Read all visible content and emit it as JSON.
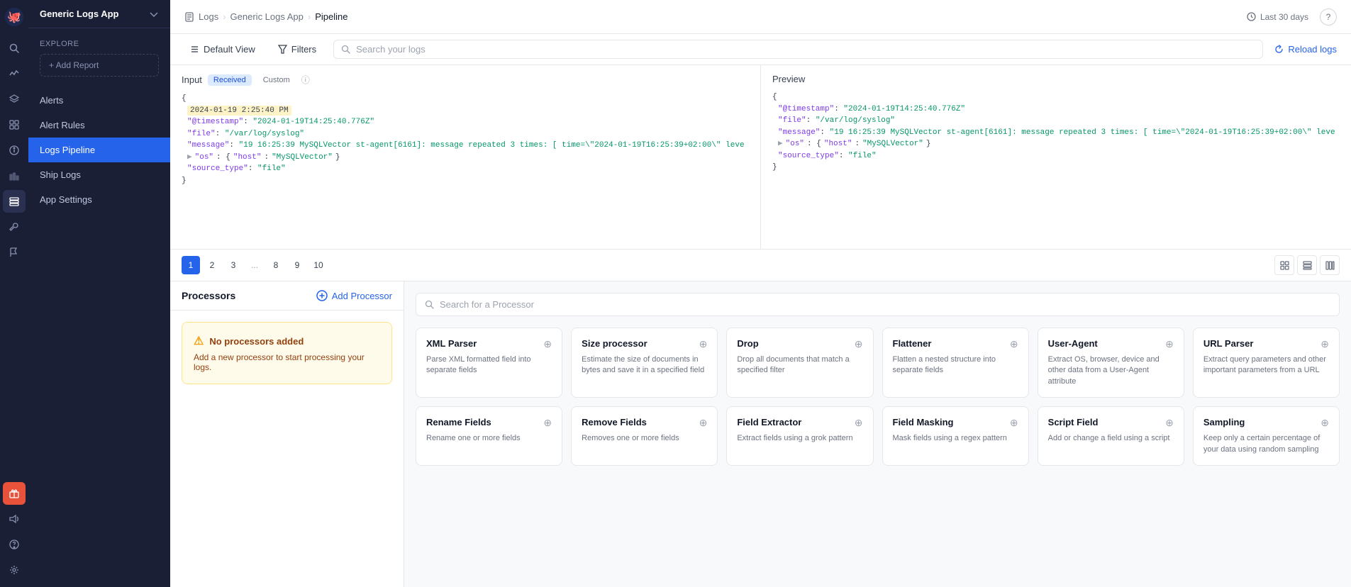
{
  "app": {
    "name": "Generic Logs App",
    "logo_text": "🐙"
  },
  "icon_bar": {
    "icons": [
      "search",
      "activity",
      "layers",
      "grid",
      "info",
      "bar-chart",
      "file-text",
      "pipeline",
      "tool",
      "flag",
      "gift",
      "volume",
      "help",
      "settings"
    ]
  },
  "sidebar": {
    "title": "Generic Logs App",
    "explore_label": "Explore",
    "add_report_label": "+ Add Report",
    "nav_items": [
      {
        "label": "Alerts",
        "active": false
      },
      {
        "label": "Alert Rules",
        "active": false
      },
      {
        "label": "Logs Pipeline",
        "active": true
      },
      {
        "label": "Ship Logs",
        "active": false
      },
      {
        "label": "App Settings",
        "active": false
      }
    ]
  },
  "topbar": {
    "breadcrumb": {
      "logs": "Logs",
      "app": "Generic Logs App",
      "current": "Pipeline"
    },
    "time_range": "Last 30 days",
    "help_label": "?"
  },
  "filter_bar": {
    "default_view": "Default View",
    "filters": "Filters",
    "search_placeholder": "Search your logs",
    "reload": "Reload logs"
  },
  "input_panel": {
    "title": "Input",
    "tab_received": "Received",
    "tab_custom": "Custom",
    "code_lines": [
      "{",
      "  \"@timestamp\": \"2024-01-19T14:25:40.776Z\"",
      "  \"file\": \"/var/log/syslog\"",
      "  \"message\": \"19 16:25:39 MySQLVector st-agent[6161]: message repeated 3 times: [ time=\\\"2024-01-19T16:25:39+02:00\\\" leve",
      "  \"os\": {\"host\": \"MySQLVector\"}",
      "  \"source_type\": \"file\"",
      "}"
    ],
    "timestamp_display": "2024-01-19 2:25:40 PM"
  },
  "preview_panel": {
    "title": "Preview",
    "code_lines": [
      "{",
      "  \"@timestamp\": \"2024-01-19T14:25:40.776Z\"",
      "  \"file\": \"/var/log/syslog\"",
      "  \"message\": \"19 16:25:39 MySQLVector st-agent[6161]: message repeated 3 times: [ time=\\\"2024-01-19T16:25:39+02:00\\\" leve",
      "  \"os\": {\"host\": \"MySQLVector\"}",
      "  \"source_type\": \"file\"",
      "}"
    ]
  },
  "pagination": {
    "pages": [
      "1",
      "2",
      "3",
      "...",
      "8",
      "9",
      "10"
    ],
    "active_page": "1"
  },
  "processors": {
    "title": "Processors",
    "add_btn": "Add Processor",
    "no_processors_title": "No processors added",
    "no_processors_desc": "Add a new processor to start processing your logs.",
    "search_placeholder": "Search for a Processor",
    "cards": [
      {
        "title": "XML Parser",
        "desc": "Parse XML formatted field into separate fields"
      },
      {
        "title": "Size processor",
        "desc": "Estimate the size of documents in bytes and save it in a specified field"
      },
      {
        "title": "Drop",
        "desc": "Drop all documents that match a specified filter"
      },
      {
        "title": "Flattener",
        "desc": "Flatten a nested structure into separate fields"
      },
      {
        "title": "User-Agent",
        "desc": "Extract OS, browser, device and other data from a User-Agent attribute"
      },
      {
        "title": "URL Parser",
        "desc": "Extract query parameters and other important parameters from a URL"
      },
      {
        "title": "Rename Fields",
        "desc": "Rename one or more fields"
      },
      {
        "title": "Remove Fields",
        "desc": "Removes one or more fields"
      },
      {
        "title": "Field Extractor",
        "desc": "Extract fields using a grok pattern"
      },
      {
        "title": "Field Masking",
        "desc": "Mask fields using a regex pattern"
      },
      {
        "title": "Script Field",
        "desc": "Add or change a field using a script"
      },
      {
        "title": "Sampling",
        "desc": "Keep only a certain percentage of your data using random sampling"
      }
    ]
  }
}
